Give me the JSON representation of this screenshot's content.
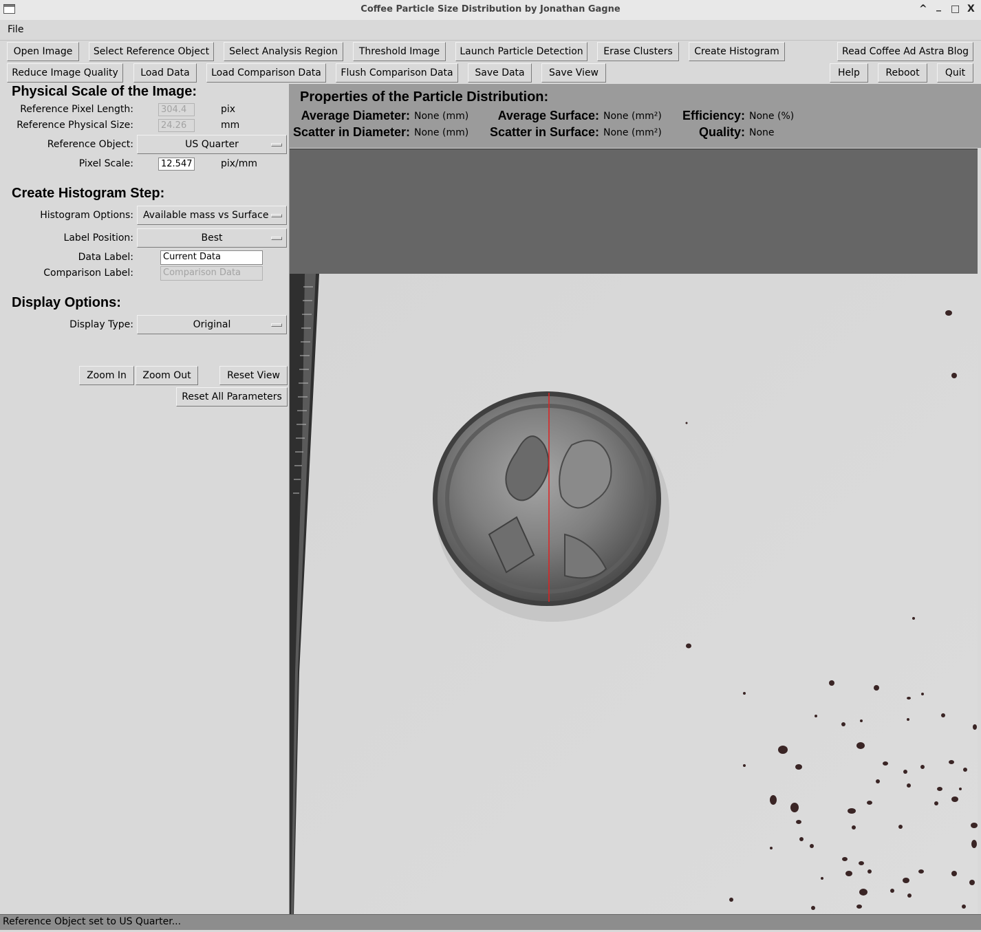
{
  "window": {
    "title": "Coffee Particle Size Distribution by Jonathan Gagne",
    "controls": [
      "^",
      "_",
      "□",
      "X"
    ]
  },
  "menu": {
    "file": "File"
  },
  "toolbar": {
    "row1": [
      "Open Image",
      "Select Reference Object",
      "Select Analysis Region",
      "Threshold Image",
      "Launch Particle Detection",
      "Erase Clusters",
      "Create Histogram",
      "Read Coffee Ad Astra Blog"
    ],
    "row2": [
      "Reduce Image Quality",
      "Load Data",
      "Load Comparison Data",
      "Flush Comparison Data",
      "Save Data",
      "Save View",
      "Help",
      "Reboot",
      "Quit"
    ]
  },
  "scale": {
    "heading": "Physical Scale of the Image:",
    "ref_pixel_length": {
      "label": "Reference Pixel Length:",
      "value": "304.4",
      "unit": "pix"
    },
    "ref_physical_size": {
      "label": "Reference Physical Size:",
      "value": "24.26",
      "unit": "mm"
    },
    "ref_object": {
      "label": "Reference Object:",
      "value": "US Quarter"
    },
    "pixel_scale": {
      "label": "Pixel Scale:",
      "value": "12.547",
      "unit": "pix/mm"
    }
  },
  "histogram": {
    "heading": "Create Histogram Step:",
    "options": {
      "label": "Histogram Options:",
      "value": "Available mass vs Surface"
    },
    "label_position": {
      "label": "Label Position:",
      "value": "Best"
    },
    "data_label": {
      "label": "Data Label:",
      "value": "Current Data"
    },
    "comparison_label": {
      "label": "Comparison Label:",
      "placeholder": "Comparison Data"
    }
  },
  "display": {
    "heading": "Display Options:",
    "type": {
      "label": "Display Type:",
      "value": "Original"
    },
    "zoom_in": "Zoom In",
    "zoom_out": "Zoom Out",
    "reset_view": "Reset View",
    "reset_all": "Reset All Parameters"
  },
  "properties": {
    "heading": "Properties of the Particle Distribution:",
    "avg_diameter": {
      "label": "Average Diameter:",
      "value": "None",
      "unit": "(mm)"
    },
    "scatter_diameter": {
      "label": "Scatter in Diameter:",
      "value": "None",
      "unit": "(mm)"
    },
    "avg_surface": {
      "label": "Average Surface:",
      "value": "None",
      "unit": "(mm²)"
    },
    "scatter_surface": {
      "label": "Scatter in Surface:",
      "value": "None",
      "unit": "(mm²)"
    },
    "efficiency": {
      "label": "Efficiency:",
      "value": "None",
      "unit": "(%)"
    },
    "quality": {
      "label": "Quality:",
      "value": "None"
    }
  },
  "image": {
    "description_icon": "coffee-grounds-photo-with-us-quarter",
    "reference_line_color": "#e02020"
  },
  "status": "Reference Object set to US Quarter..."
}
